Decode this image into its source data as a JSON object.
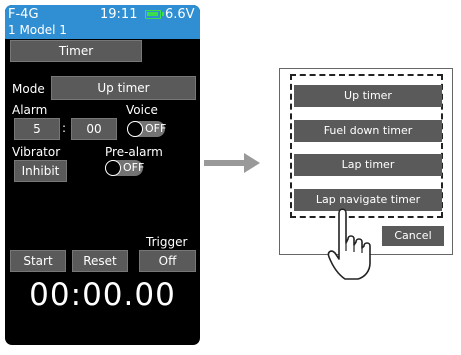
{
  "status": {
    "left": "F-4G",
    "clock": "19:11",
    "battery": "6.6V",
    "model": "1   Model 1"
  },
  "screen": {
    "title": "Timer",
    "mode_label": "Mode",
    "mode_value": "Up timer",
    "alarm_label": "Alarm",
    "alarm_min": "5",
    "colon": ":",
    "alarm_sec": "00",
    "voice_label": "Voice",
    "voice_state": "OFF",
    "vibrator_label": "Vibrator",
    "vibrator_value": "Inhibit",
    "prealarm_label": "Pre-alarm",
    "prealarm_state": "OFF",
    "trigger_label": "Trigger",
    "start": "Start",
    "reset": "Reset",
    "trigger_value": "Off",
    "time": "00:00.00"
  },
  "popup": {
    "options": [
      "Up timer",
      "Fuel down timer",
      "Lap timer",
      "Lap navigate timer"
    ],
    "cancel": "Cancel"
  },
  "colors": {
    "status_bar": "#2f8fd2",
    "button": "#5a5a5a",
    "battery": "#39e04a"
  },
  "icons": {
    "arrow": "right-arrow-icon",
    "hand": "pointing-hand-icon",
    "battery": "battery-icon"
  }
}
